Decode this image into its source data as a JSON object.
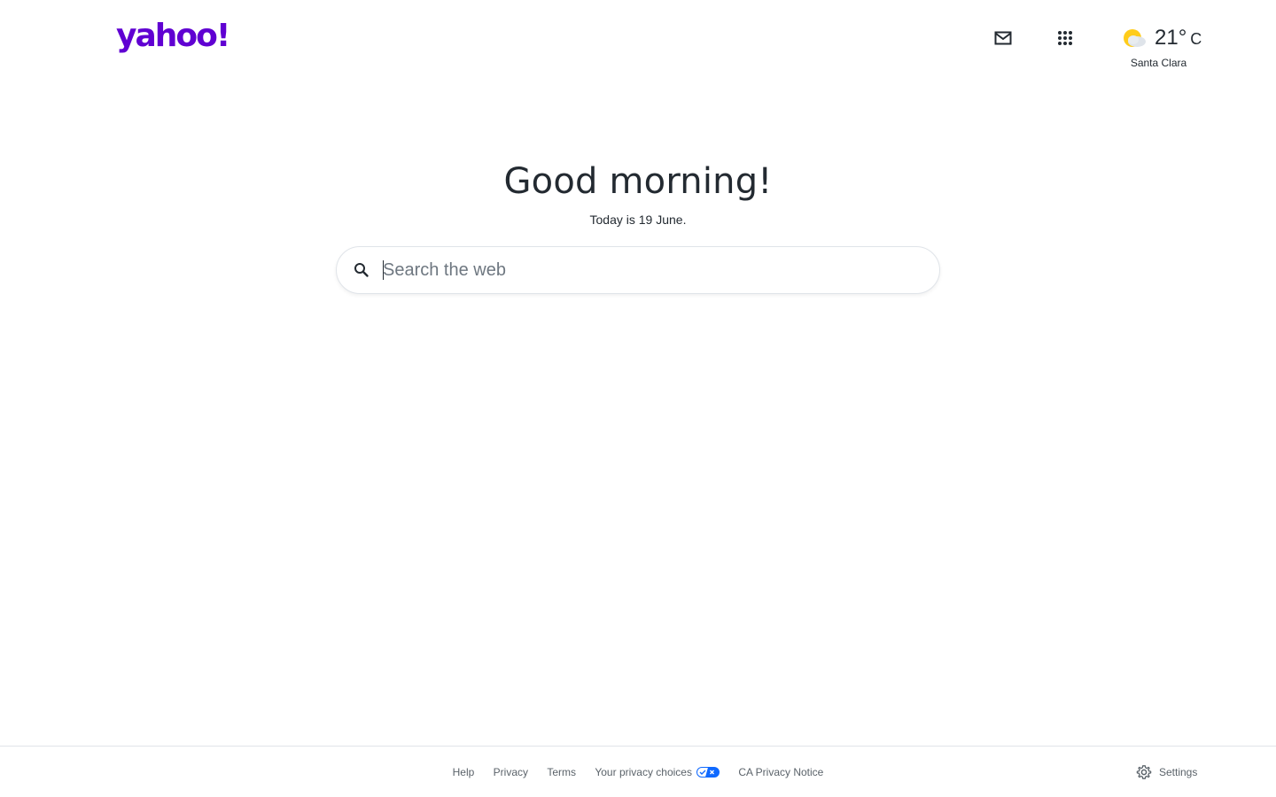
{
  "header": {
    "logo_text": "yahoo!",
    "mail_icon": "mail-icon",
    "apps_icon": "apps-grid-icon",
    "weather": {
      "icon": "partly-cloudy-icon",
      "temperature": "21°",
      "unit": "C",
      "city": "Santa Clara"
    }
  },
  "main": {
    "greeting": "Good morning!",
    "date_line": "Today is 19 June.",
    "search": {
      "placeholder": "Search the web",
      "value": ""
    }
  },
  "footer": {
    "links": [
      "Help",
      "Privacy",
      "Terms",
      "Your privacy choices",
      "CA Privacy Notice"
    ],
    "settings_label": "Settings"
  },
  "colors": {
    "brand": "#6001d2",
    "text": "#232a31",
    "muted": "#5b636a",
    "privacy_badge": "#0f69ff"
  }
}
